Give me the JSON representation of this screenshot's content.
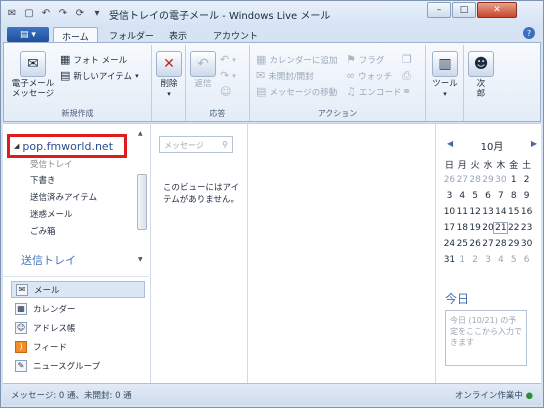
{
  "window": {
    "title": "受信トレイの電子メール - Windows Live メール"
  },
  "ribbon_tabs": [
    "ホーム",
    "フォルダー",
    "表示",
    "アカウント"
  ],
  "groups": {
    "new": {
      "label": "新規作成",
      "email": "電子メール\nメッセージ",
      "photo": "フォト メール",
      "new_item": "新しいアイテム"
    },
    "delete": {
      "label": "削除"
    },
    "reply": {
      "label": "応答",
      "reply": "返信"
    },
    "actions": {
      "label": "アクション",
      "add_cal": "カレンダーに追加",
      "unread": "未開封/開封",
      "move": "メッセージの移動",
      "flag": "フラグ",
      "watch": "ウォッチ",
      "encode": "エンコード"
    },
    "tools": {
      "label": "ツール"
    },
    "user": {
      "label": "次\n郎"
    }
  },
  "folders": {
    "account": "pop.fmworld.net",
    "items": [
      "受信トレイ",
      "下書き",
      "送信済みアイテム",
      "迷惑メール",
      "ごみ箱"
    ],
    "section": "送信トレイ"
  },
  "nav": [
    "メール",
    "カレンダー",
    "アドレス帳",
    "フィード",
    "ニュースグループ"
  ],
  "list": {
    "search_placeholder": "メッセージ",
    "empty": "このビューにはアイテムがありません。"
  },
  "calendar": {
    "month": "10月",
    "days": [
      "日",
      "月",
      "火",
      "水",
      "木",
      "金",
      "土"
    ],
    "weeks": [
      [
        "26",
        "27",
        "28",
        "29",
        "30",
        "1",
        "2"
      ],
      [
        "3",
        "4",
        "5",
        "6",
        "7",
        "8",
        "9"
      ],
      [
        "10",
        "11",
        "12",
        "13",
        "14",
        "15",
        "16"
      ],
      [
        "17",
        "18",
        "19",
        "20",
        "21",
        "22",
        "23"
      ],
      [
        "24",
        "25",
        "26",
        "27",
        "28",
        "29",
        "30"
      ],
      [
        "31",
        "1",
        "2",
        "3",
        "4",
        "5",
        "6"
      ]
    ],
    "today_label": "今日",
    "today_box": "今日 (10/21) の予定をここから入力できます"
  },
  "status": {
    "left": "メッセージ: 0 通、未開封: 0 通",
    "right": "オンライン作業中"
  }
}
